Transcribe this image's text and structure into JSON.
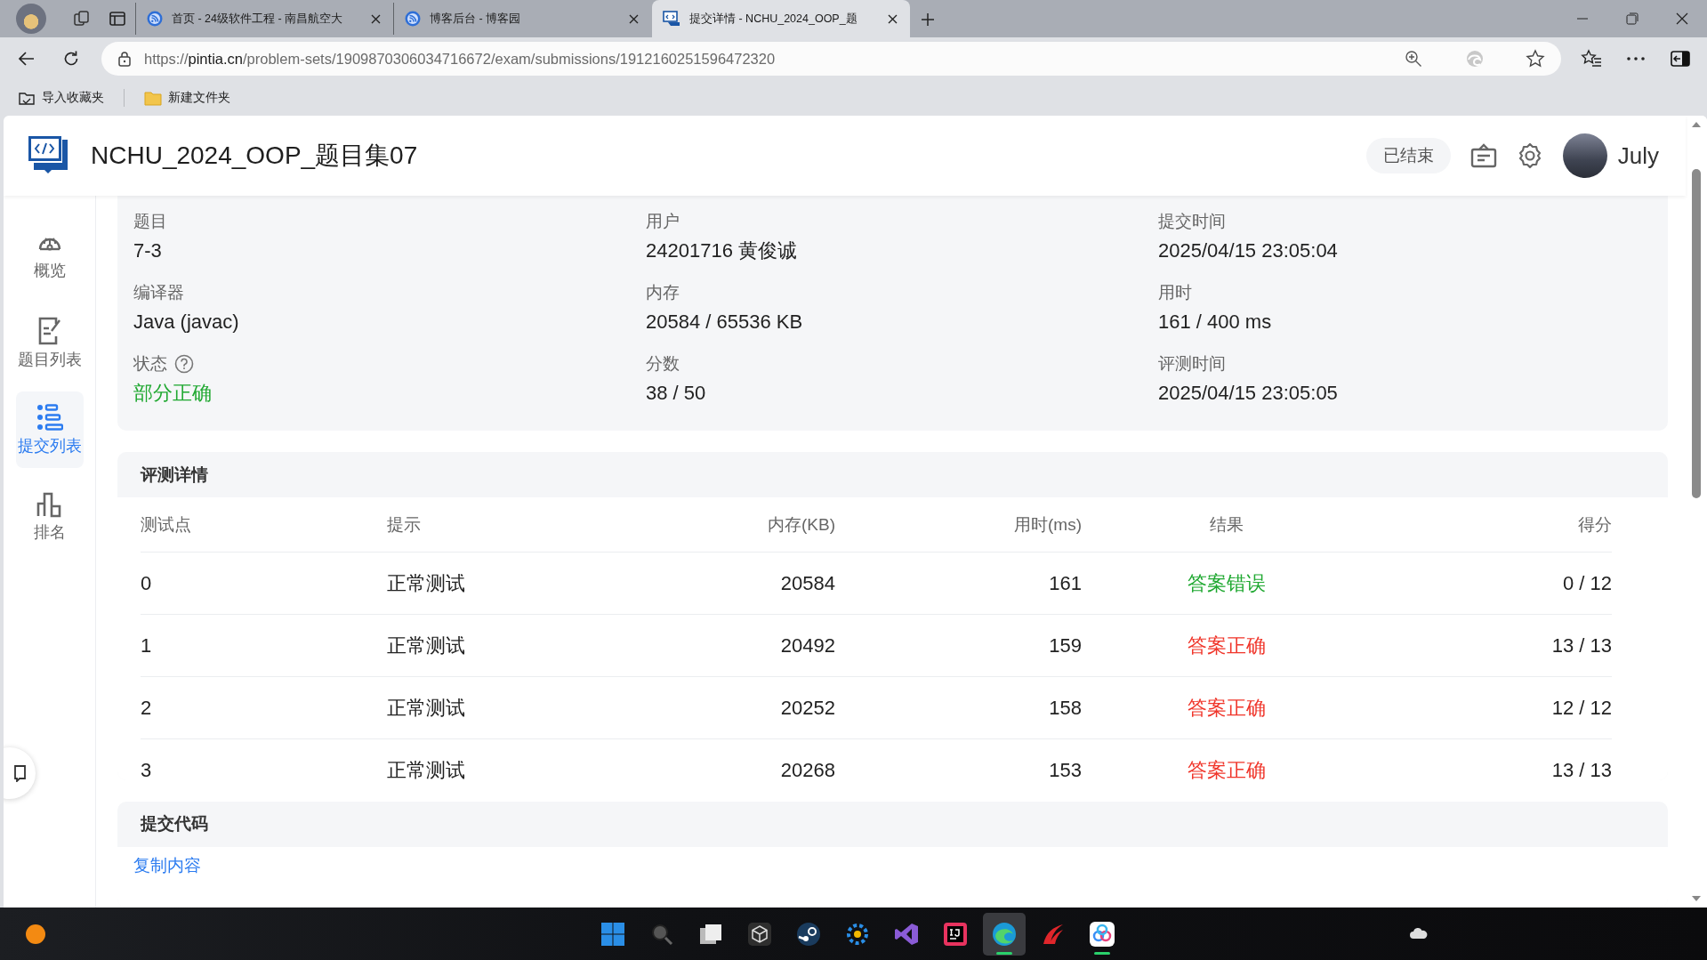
{
  "browser": {
    "tabs": [
      {
        "title": "首页 - 24级软件工程 - 南昌航空大",
        "kind": "blog",
        "selected": false
      },
      {
        "title": "博客后台 - 博客园",
        "kind": "blog",
        "selected": false
      },
      {
        "title": "提交详情 - NCHU_2024_OOP_题",
        "kind": "code",
        "selected": true
      }
    ],
    "url": {
      "scheme": "https://",
      "host": "pintia.cn",
      "path": "/problem-sets/1909870306034716672/exam/submissions/1912160251596472320"
    },
    "bookmarks": [
      {
        "label": "导入收藏夹",
        "kind": "import"
      },
      {
        "label": "新建文件夹",
        "kind": "folder"
      }
    ]
  },
  "header": {
    "title": "NCHU_2024_OOP_题目集07",
    "badge": "已结束",
    "user": "July"
  },
  "sidebar": [
    {
      "label": "概览",
      "kind": "dashboard",
      "selected": false
    },
    {
      "label": "题目列表",
      "kind": "problems",
      "selected": false
    },
    {
      "label": "提交列表",
      "kind": "submissions",
      "selected": true
    },
    {
      "label": "排名",
      "kind": "ranking",
      "selected": false
    }
  ],
  "info": [
    {
      "label": "题目",
      "value": "7-3",
      "kind": "plain"
    },
    {
      "label": "用户",
      "value": "24201716 黄俊诚",
      "kind": "plain"
    },
    {
      "label": "提交时间",
      "value": "2025/04/15 23:05:04",
      "kind": "plain"
    },
    {
      "label": "编译器",
      "value": "Java (javac)",
      "kind": "plain"
    },
    {
      "label": "内存",
      "value": "20584 / 65536 KB",
      "kind": "plain"
    },
    {
      "label": "用时",
      "value": "161 / 400 ms",
      "kind": "plain"
    },
    {
      "label": "状态",
      "value": "部分正确",
      "kind": "status"
    },
    {
      "label": "分数",
      "value": "38 / 50",
      "kind": "plain"
    },
    {
      "label": "评测时间",
      "value": "2025/04/15 23:05:05",
      "kind": "plain"
    }
  ],
  "judge": {
    "title": "评测详情",
    "columns": [
      "测试点",
      "提示",
      "内存(KB)",
      "用时(ms)",
      "结果",
      "得分"
    ],
    "rows": [
      {
        "cells": [
          "0",
          "正常测试",
          "20584",
          "161",
          "答案错误",
          "0 / 12"
        ],
        "color": "#1fa830"
      },
      {
        "cells": [
          "1",
          "正常测试",
          "20492",
          "159",
          "答案正确",
          "13 / 13"
        ],
        "color": "#f0352a"
      },
      {
        "cells": [
          "2",
          "正常测试",
          "20252",
          "158",
          "答案正确",
          "12 / 12"
        ],
        "color": "#f0352a"
      },
      {
        "cells": [
          "3",
          "正常测试",
          "20268",
          "153",
          "答案正确",
          "13 / 13"
        ],
        "color": "#f0352a"
      }
    ]
  },
  "code": {
    "title": "提交代码",
    "copy_link": "复制内容"
  },
  "taskbar": {
    "apps": [
      {
        "kind": "windows",
        "selected": false,
        "running": false
      },
      {
        "kind": "search",
        "selected": false,
        "running": false
      },
      {
        "kind": "taskview",
        "selected": false,
        "running": false
      },
      {
        "kind": "cube",
        "selected": false,
        "running": false
      },
      {
        "kind": "steam",
        "selected": false,
        "running": false
      },
      {
        "kind": "gearapp",
        "selected": false,
        "running": false
      },
      {
        "kind": "vs",
        "selected": false,
        "running": false
      },
      {
        "kind": "ij",
        "selected": false,
        "running": false
      },
      {
        "kind": "edge",
        "selected": true,
        "running": true
      },
      {
        "kind": "swirl",
        "selected": false,
        "running": false
      },
      {
        "kind": "cloudapp",
        "selected": false,
        "running": true
      }
    ]
  }
}
